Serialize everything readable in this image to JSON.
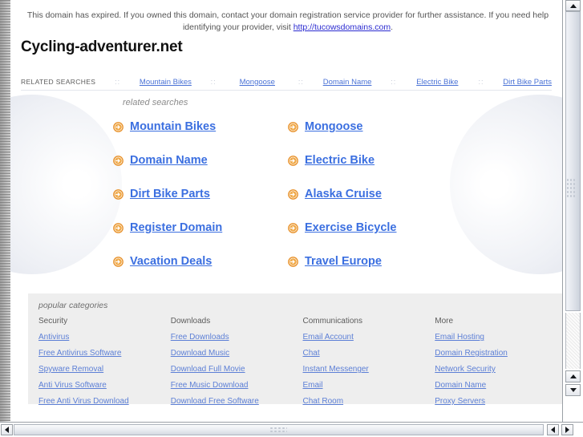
{
  "banner": {
    "text_before": "This domain has expired. If you owned this domain, contact your domain registration service provider for further assistance. If you need help identifying your provider, visit ",
    "link_text": "http://tucowsdomains.com",
    "text_after": "."
  },
  "domain_title": "Cycling-adventurer.net",
  "navbar": {
    "label": "RELATED SEARCHES",
    "separator": "::",
    "links": [
      "Mountain Bikes",
      "Mongoose",
      "Domain Name",
      "Electric Bike",
      "Dirt Bike Parts"
    ]
  },
  "related_searches": {
    "caption": "related searches",
    "icon": "arrow-circle-right-icon",
    "links": [
      "Mountain Bikes",
      "Mongoose",
      "Domain Name",
      "Electric Bike",
      "Dirt Bike Parts",
      "Alaska Cruise",
      "Register Domain",
      "Exercise Bicycle",
      "Vacation Deals",
      "Travel Europe"
    ]
  },
  "popular_categories": {
    "caption": "popular categories",
    "columns": [
      {
        "heading": "Security",
        "links": [
          "Antivirus",
          "Free Antivirus Software",
          "Spyware Removal",
          "Anti Virus Software",
          "Free Anti Virus Download"
        ]
      },
      {
        "heading": "Downloads",
        "links": [
          "Free Downloads",
          "Download Music",
          "Download Full Movie",
          "Free Music Download",
          "Download Free Software"
        ]
      },
      {
        "heading": "Communications",
        "links": [
          "Email Account",
          "Chat",
          "Instant Messenger",
          "Email",
          "Chat Room"
        ]
      },
      {
        "heading": "More",
        "links": [
          "Email Hosting",
          "Domain Registration",
          "Network Security",
          "Domain Name",
          "Proxy Servers"
        ]
      }
    ]
  },
  "colors": {
    "link_blue": "#3b6fe0",
    "nav_link_blue": "#4a72d6",
    "footer_link_blue": "#5c7fd6",
    "banner_link": "#2a2ad0",
    "arrow_orange": "#e8912a",
    "footer_bg": "#eeeeee"
  },
  "scrollbars": {
    "v_up": "scroll-up-icon",
    "v_down": "scroll-down-icon",
    "h_left": "scroll-left-icon",
    "h_right": "scroll-right-icon"
  }
}
